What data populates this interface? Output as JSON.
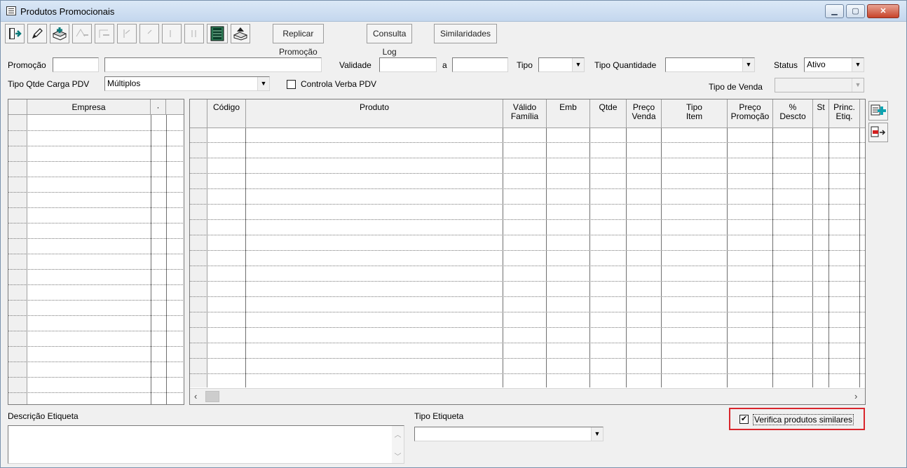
{
  "window": {
    "title": "Produtos Promocionais"
  },
  "toolbar": {
    "buttons": [
      {
        "name": "exit-icon",
        "enabled": true
      },
      {
        "name": "edit-pencil-icon",
        "enabled": true
      },
      {
        "name": "add-record-icon",
        "enabled": true
      },
      {
        "name": "remove-record-icon",
        "enabled": false
      },
      {
        "name": "cancel-record-icon",
        "enabled": false
      },
      {
        "name": "first-record-icon",
        "enabled": false
      },
      {
        "name": "prev-record-icon",
        "enabled": false
      },
      {
        "name": "next-record-icon",
        "enabled": false
      },
      {
        "name": "last-record-icon",
        "enabled": false
      },
      {
        "name": "grid-view-icon",
        "enabled": true
      },
      {
        "name": "export-icon",
        "enabled": true
      }
    ],
    "replicar_label": "Replicar Promoção",
    "consulta_label": "Consulta Log",
    "similaridades_label": "Similaridades"
  },
  "filters": {
    "promocao_label": "Promoção",
    "promocao_code": "",
    "promocao_desc": "",
    "validade_label": "Validade",
    "validade_from": "",
    "validade_to_label": "a",
    "validade_to": "",
    "tipo_label": "Tipo",
    "tipo_value": "",
    "tipo_quantidade_label": "Tipo Quantidade",
    "tipo_quantidade_value": "",
    "status_label": "Status",
    "status_value": "Ativo",
    "tipo_carga_label": "Tipo Qtde Carga PDV",
    "tipo_carga_value": "Múltiplos",
    "controla_verba_label": "Controla Verba PDV",
    "controla_verba_checked": false,
    "tipo_venda_label": "Tipo de Venda",
    "tipo_venda_value": ""
  },
  "empresa_grid": {
    "columns": [
      "Empresa",
      "·"
    ]
  },
  "produto_grid": {
    "columns": [
      {
        "label": "Código"
      },
      {
        "label": "Produto"
      },
      {
        "label": "Válido\nFamília"
      },
      {
        "label": "Emb"
      },
      {
        "label": "Qtde"
      },
      {
        "label": "Preço\nVenda"
      },
      {
        "label": "Tipo\nItem"
      },
      {
        "label": "Preço\nPromoção"
      },
      {
        "label": "%\nDescto"
      },
      {
        "label": "St"
      },
      {
        "label": "Princ.\nEtiq."
      }
    ]
  },
  "bottom": {
    "descricao_label": "Descrição Etiqueta",
    "descricao_value": "",
    "tipo_etiqueta_label": "Tipo Etiqueta",
    "tipo_etiqueta_value": "",
    "verifica_label": "Verifica produtos similares",
    "verifica_checked": true
  },
  "colors": {
    "highlight": "#d9262c",
    "titlebar": "#c4d7ee"
  }
}
